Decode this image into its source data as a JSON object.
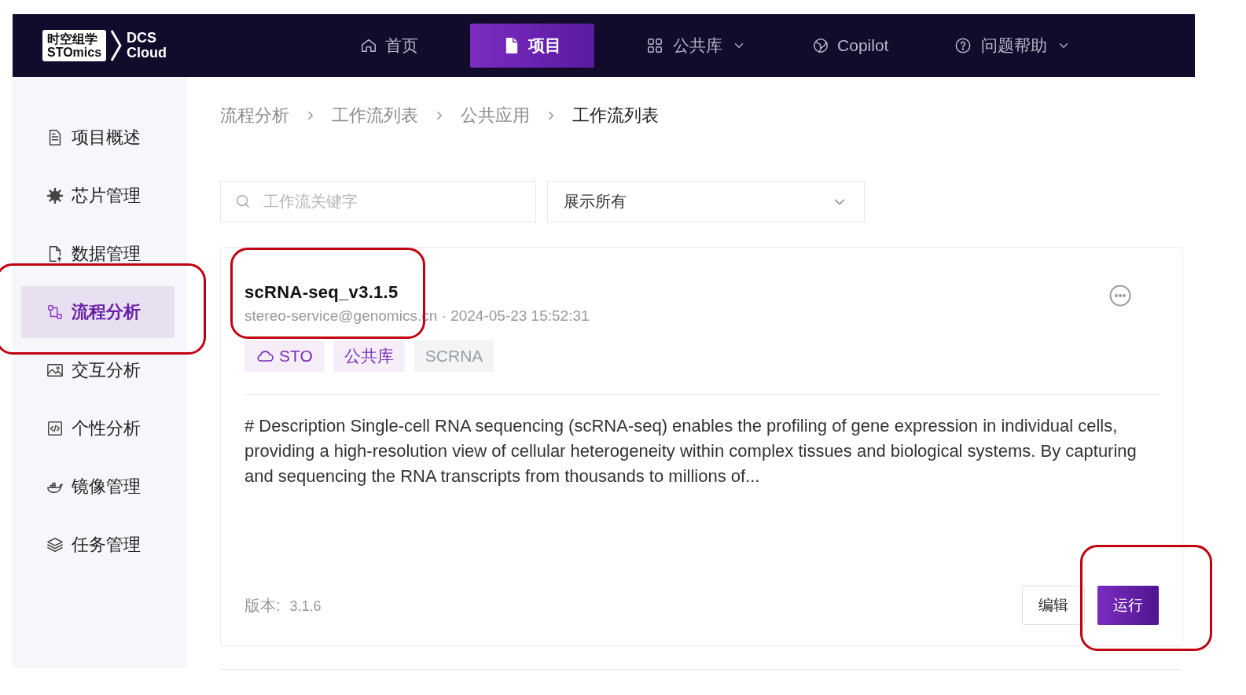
{
  "nav": {
    "logo_lines": [
      "时空组学",
      "STOmics"
    ],
    "product_lines": [
      "DCS",
      "Cloud"
    ],
    "items": [
      {
        "label": "首页",
        "selected": false,
        "dropdown": false
      },
      {
        "label": "项目",
        "selected": true,
        "dropdown": false
      },
      {
        "label": "公共库",
        "selected": false,
        "dropdown": true
      },
      {
        "label": "Copilot",
        "selected": false,
        "dropdown": false
      },
      {
        "label": "问题帮助",
        "selected": false,
        "dropdown": true
      }
    ]
  },
  "sidebar": {
    "items": [
      {
        "label": "项目概述",
        "selected": false,
        "highlighted": false
      },
      {
        "label": "芯片管理",
        "selected": false,
        "highlighted": false
      },
      {
        "label": "数据管理",
        "selected": false,
        "highlighted": false
      },
      {
        "label": "流程分析",
        "selected": true,
        "highlighted": true
      },
      {
        "label": "交互分析",
        "selected": false,
        "highlighted": false
      },
      {
        "label": "个性分析",
        "selected": false,
        "highlighted": false
      },
      {
        "label": "镜像管理",
        "selected": false,
        "highlighted": false
      },
      {
        "label": "任务管理",
        "selected": false,
        "highlighted": false
      }
    ]
  },
  "breadcrumb": [
    "流程分析",
    "工作流列表",
    "公共应用",
    "工作流列表"
  ],
  "search": {
    "placeholder": "工作流关键字"
  },
  "filter": {
    "value": "展示所有"
  },
  "workflow": {
    "title": "scRNA-seq_v3.1.5",
    "highlighted": true,
    "meta": "stereo-service@genomics.cn · 2024-05-23 15:52:31",
    "tags": [
      {
        "label": "STO",
        "kind": "cloud"
      },
      {
        "label": "公共库",
        "kind": "purple"
      },
      {
        "label": "SCRNA",
        "kind": "grey"
      }
    ],
    "description": "# Description Single-cell RNA sequencing (scRNA-seq) enables the profiling of gene expression in individual cells, providing a high-resolution view of cellular heterogeneity within complex tissues and biological systems. By capturing and sequencing the RNA transcripts from thousands to millions of...",
    "version_label": "版本:",
    "version": "3.1.6",
    "buttons": [
      {
        "label": "编辑",
        "kind": "default",
        "highlighted": false
      },
      {
        "label": "运行",
        "kind": "primary",
        "highlighted": true
      }
    ]
  }
}
